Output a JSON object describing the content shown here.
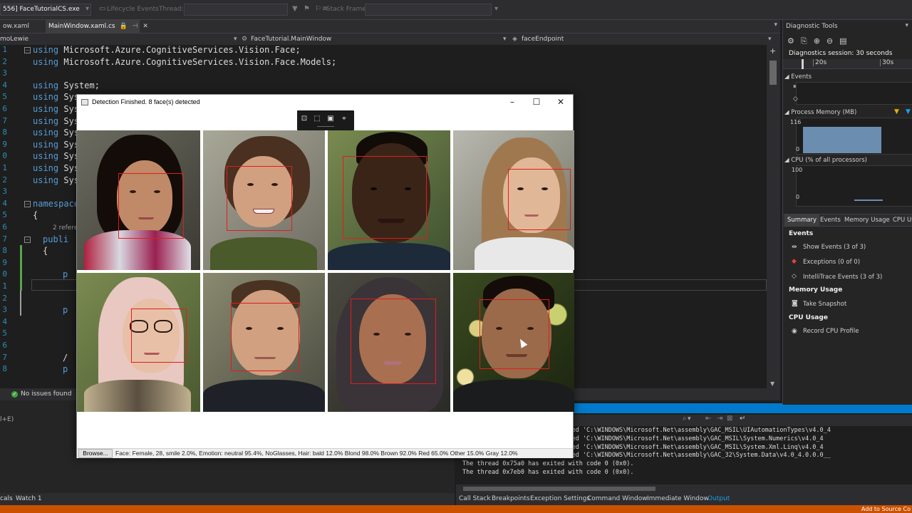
{
  "toolbar": {
    "process": "556] FaceTutorialCS.exe",
    "lifecycle": "Lifecycle Events",
    "thread_label": "Thread:",
    "stack_label": "Stack Frame:"
  },
  "editor_tabs": [
    {
      "label": "ow.xaml",
      "active": false
    },
    {
      "label": "MainWindow.xaml.cs",
      "active": true
    }
  ],
  "navbar": {
    "project": "moLewie",
    "class": "FaceTutorial.MainWindow",
    "member": "faceEndpoint"
  },
  "code": {
    "line_numbers": [
      "1",
      "2",
      "3",
      "4",
      "5",
      "6",
      "7",
      "8",
      "9",
      "0",
      "1",
      "2",
      "3",
      "4",
      "5",
      "6",
      "7",
      "8",
      "9",
      "0",
      "1",
      "2",
      "3",
      "4",
      "5",
      "6",
      "7",
      "8"
    ],
    "lines": [
      {
        "kw": "using",
        "text": " Microsoft.Azure.CognitiveServices.Vision.Face;"
      },
      {
        "kw": "using",
        "text": " Microsoft.Azure.CognitiveServices.Vision.Face.Models;"
      },
      {
        "kw": "",
        "text": ""
      },
      {
        "kw": "using",
        "text": " System;"
      },
      {
        "kw": "using",
        "text": " Sys"
      },
      {
        "kw": "using",
        "text": " Sys"
      },
      {
        "kw": "using",
        "text": " Sys"
      },
      {
        "kw": "using",
        "text": " Sys"
      },
      {
        "kw": "using",
        "text": " Sys"
      },
      {
        "kw": "using",
        "text": " Sys"
      },
      {
        "kw": "using",
        "text": " Sys"
      },
      {
        "kw": "using",
        "text": " Sys"
      },
      {
        "kw": "",
        "text": ""
      },
      {
        "kw": "namespace",
        "text": ""
      },
      {
        "kw": "",
        "text": "{"
      },
      {
        "kw": "",
        "text": ""
      },
      {
        "kw": "publi",
        "text": ""
      },
      {
        "kw": "",
        "text": "{"
      },
      {
        "kw": "",
        "text": ""
      },
      {
        "kw": "p",
        "text": ""
      },
      {
        "kw": "",
        "text": ""
      },
      {
        "kw": "",
        "text": ""
      },
      {
        "kw": "p",
        "text": ""
      },
      {
        "kw": "",
        "text": ""
      },
      {
        "kw": "",
        "text": ""
      },
      {
        "kw": "",
        "text": ""
      },
      {
        "kw": "",
        "text": "/"
      },
      {
        "kw": "p",
        "text": ""
      }
    ],
    "refs_text": "2 refere"
  },
  "editor_status": {
    "issues": "No issues found"
  },
  "bottom_left": {
    "side_text": "l+E)",
    "tabs": [
      "cals",
      "Watch 1"
    ]
  },
  "output": {
    "lines": [
      "319: FaceTutorialCS.exe): Loaded 'C:\\WINDOWS\\Microsoft.Net\\assembly\\GAC_MSIL\\UIAutomationTypes\\v4.0_4",
      "319: FaceTutorialCS.exe): Loaded 'C:\\WINDOWS\\Microsoft.Net\\assembly\\GAC_MSIL\\System.Numerics\\v4.0_4",
      "319: FaceTutorialCS.exe): Loaded 'C:\\WINDOWS\\Microsoft.Net\\assembly\\GAC_MSIL\\System.Xml.Linq\\v4.0_4",
      "319: FaceTutorialCS.exe): Loaded 'C:\\WINDOWS\\Microsoft.Net\\assembly\\GAC_32\\System.Data\\v4.0_4.0.0.0__",
      "The thread 0x75a0 has exited with code 0 (0x0).",
      "The thread 0x7eb0 has exited with code 0 (0x0)."
    ]
  },
  "debug_tabs": [
    "Call Stack",
    "Breakpoints",
    "Exception Settings",
    "Command Window",
    "Immediate Window",
    "Output"
  ],
  "status_bar": {
    "right": "Add to Source Co"
  },
  "diagnostics": {
    "title": "Diagnostic Tools",
    "session": "Diagnostics session: 30 seconds",
    "ruler": [
      "20s",
      "30s"
    ],
    "events_label": "Events",
    "memory_label": "Process Memory (MB)",
    "memory_max": "116",
    "memory_min": "0",
    "cpu_label": "CPU (% of all processors)",
    "cpu_max": "100",
    "cpu_min": "0",
    "tabs": [
      "Summary",
      "Events",
      "Memory Usage",
      "CPU Us"
    ],
    "summary": {
      "events_head": "Events",
      "show_events": "Show Events (3 of 3)",
      "exceptions": "Exceptions (0 of 0)",
      "intellitrace": "IntelliTrace Events (3 of 3)",
      "memory_head": "Memory Usage",
      "snapshot": "Take Snapshot",
      "cpu_head": "CPU Usage",
      "cpu_profile": "Record CPU Profile"
    },
    "memory_fill_fraction": 0.8
  },
  "dialog": {
    "title": "Detection Finished. 8 face(s) detected",
    "browse": "Browse...",
    "face_info": "Face: Female, 28, smile 2.0%, Emotion: neutral 95.4%, NoGlasses, Hair: bald 12.0% Blond 98.0% Brown 92.0% Red 65.0% Other 15.0% Gray 12.0%"
  },
  "colors": {
    "accent": "#007acc",
    "status_bar": "#ca5100",
    "bbox": "#e11d1d"
  }
}
